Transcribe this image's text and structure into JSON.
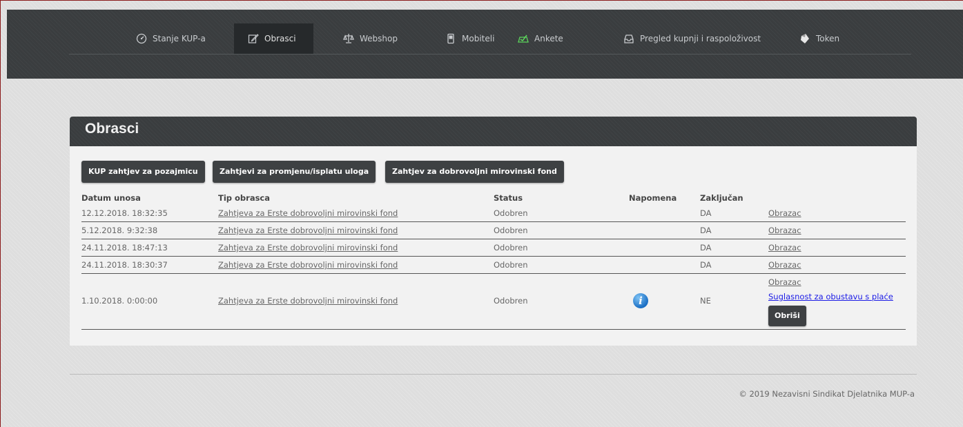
{
  "nav": {
    "items": [
      {
        "label": "Stanje KUP-a",
        "icon": "gauge-icon"
      },
      {
        "label": "Obrasci",
        "icon": "edit-icon",
        "active": true
      },
      {
        "label": "Webshop",
        "icon": "scale-icon"
      },
      {
        "label": "Mobiteli",
        "icon": "phone-icon"
      },
      {
        "label": "Ankete",
        "icon": "poll-icon"
      },
      {
        "label": "Pregled kupnji i raspoloživost",
        "icon": "inbox-icon"
      },
      {
        "label": "Token",
        "icon": "token-icon"
      }
    ]
  },
  "page": {
    "title": "Obrasci",
    "buttons": {
      "loan": "KUP zahtjev za pozajmicu",
      "change": "Zahtjevi za promjenu/isplatu uloga",
      "pension": "Zahtjev za dobrovoljni mirovinski fond"
    }
  },
  "table": {
    "headers": {
      "date": "Datum unosa",
      "type": "Tip obrasca",
      "status": "Status",
      "note": "Napomena",
      "locked": "Zaključan"
    },
    "rows": [
      {
        "date": "12.12.2018. 18:32:35",
        "type": "Zahtjeva za Erste dobrovoljni mirovinski fond",
        "status": "Odobren",
        "locked": "DA",
        "link": "Obrazac"
      },
      {
        "date": "5.12.2018. 9:32:38",
        "type": "Zahtjeva za Erste dobrovoljni mirovinski fond",
        "status": "Odobren",
        "locked": "DA",
        "link": "Obrazac"
      },
      {
        "date": "24.11.2018. 18:47:13",
        "type": "Zahtjeva za Erste dobrovoljni mirovinski fond",
        "status": "Odobren",
        "locked": "DA",
        "link": "Obrazac"
      },
      {
        "date": "24.11.2018. 18:30:37",
        "type": "Zahtjeva za Erste dobrovoljni mirovinski fond",
        "status": "Odobren",
        "locked": "DA",
        "link": "Obrazac"
      },
      {
        "date": "1.10.2018. 0:00:00",
        "type": "Zahtjeva za Erste dobrovoljni mirovinski fond",
        "status": "Odobren",
        "locked": "NE",
        "link": "Obrazac",
        "link2": "Suglasnost za obustavu s plaće",
        "delete": "Obriši",
        "info_icon": "info-icon"
      }
    ]
  },
  "footer": {
    "text": "© 2019 Nezavisni Sindikat Djelatnika MUP-a"
  }
}
